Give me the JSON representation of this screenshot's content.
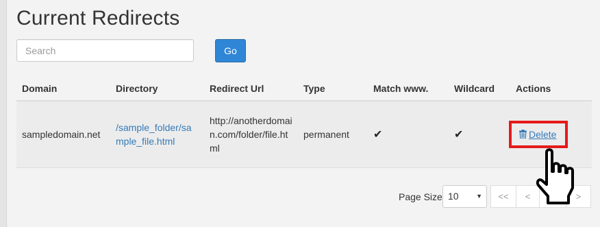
{
  "page": {
    "title": "Current Redirects"
  },
  "search": {
    "placeholder": "Search",
    "value": "",
    "go_label": "Go"
  },
  "table": {
    "headers": [
      "Domain",
      "Directory",
      "Redirect Url",
      "Type",
      "Match www.",
      "Wildcard",
      "Actions"
    ],
    "rows": [
      {
        "domain": "sampledomain.net",
        "directory": "/sample_folder/sample_file.html",
        "redirect_url": "http://anotherdomain.com/folder/file.html",
        "type": "permanent",
        "match_www": "✔",
        "wildcard": "✔",
        "action_label": "Delete"
      }
    ]
  },
  "pagination": {
    "page_size_label": "Page Size",
    "page_size": "10",
    "first": "<<",
    "prev": "<",
    "next": ">"
  },
  "colors": {
    "accent": "#2f86d6",
    "link": "#337ab7",
    "highlight_box": "#e51a1a"
  }
}
